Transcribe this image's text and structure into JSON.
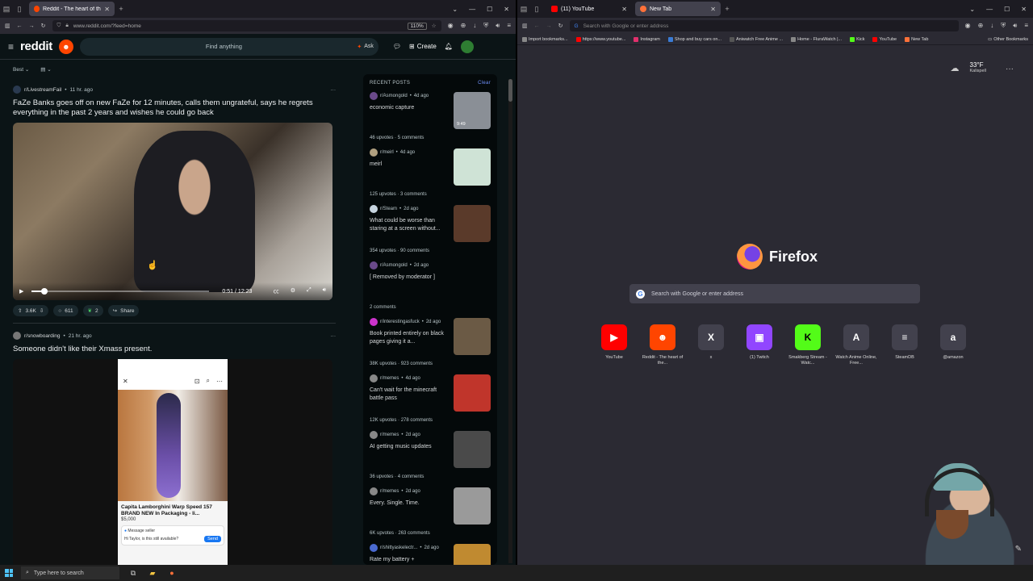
{
  "left_browser": {
    "tab": {
      "title": "Reddit - The heart of the in"
    },
    "url": "www.reddit.com/?feed=home",
    "zoom": "110%"
  },
  "reddit": {
    "logo": "reddit",
    "search_placeholder": "Find anything",
    "ask_label": "Ask",
    "create_label": "Create",
    "sort_label": "Best"
  },
  "posts": [
    {
      "subreddit": "r/LivestreamFail",
      "time": "11 hr. ago",
      "title": "FaZe Banks goes off on new FaZe for 12 minutes, calls them ungrateful, says he regrets everything in the past 2 years and wishes he could go back",
      "video_time": "0:51 / 12:23",
      "progress_fraction": 0.069,
      "upvotes": "3.6K",
      "comments": "611",
      "awards": "2",
      "share_label": "Share"
    },
    {
      "subreddit": "r/snowboarding",
      "time": "21 hr. ago",
      "title": "Someone didn't like their Xmass present.",
      "listing_title": "Capita Lamborghini Warp Speed 157 BRAND NEW In Packaging - li...",
      "listing_price": "$5,000",
      "message_header": "Message seller",
      "message_text": "Hi Taylor, is this still available?",
      "send_label": "Send"
    }
  ],
  "recent_posts": {
    "heading": "RECENT POSTS",
    "clear_label": "Clear",
    "items": [
      {
        "sub": "r/Asmongold",
        "time": "4d ago",
        "title": "economic capture",
        "stats": "46 upvotes · 5 comments",
        "thumb_label": "9:49",
        "icon_color": "#6a4a8a",
        "thumb_color": "#8a8f96"
      },
      {
        "sub": "r/meirl",
        "time": "4d ago",
        "title": "meirl",
        "stats": "125 upvotes · 3 comments",
        "thumb_label": "",
        "icon_color": "#b0a080",
        "thumb_color": "#cfe3d6"
      },
      {
        "sub": "r/Steam",
        "time": "2d ago",
        "title": "What could be worse than staring at a screen without...",
        "stats": "354 upvotes · 90 comments",
        "thumb_label": "",
        "icon_color": "#c7d5e0",
        "thumb_color": "#5a3a2a"
      },
      {
        "sub": "r/Asmongold",
        "time": "2d ago",
        "title": "[ Removed by moderator ]",
        "stats": "2 comments",
        "thumb_label": "",
        "icon_color": "#6a4a8a",
        "thumb_color": ""
      },
      {
        "sub": "r/interestingasfuck",
        "time": "2d ago",
        "title": "Book printed entirely on black pages giving it a...",
        "stats": "38K upvotes · 923 comments",
        "thumb_label": "",
        "icon_color": "#cc33cc",
        "thumb_color": "#6b5a45"
      },
      {
        "sub": "r/memes",
        "time": "4d ago",
        "title": "Can't wait for the minecraft battle pass",
        "stats": "12K upvotes · 278 comments",
        "thumb_label": "",
        "icon_color": "#888888",
        "thumb_color": "#c0352b"
      },
      {
        "sub": "r/memes",
        "time": "2d ago",
        "title": "AI getting music updates",
        "stats": "36 upvotes · 4 comments",
        "thumb_label": "",
        "icon_color": "#888888",
        "thumb_color": "#4a4a4a"
      },
      {
        "sub": "r/memes",
        "time": "2d ago",
        "title": "Every. Single. Time.",
        "stats": "6K upvotes · 263 comments",
        "thumb_label": "",
        "icon_color": "#888888",
        "thumb_color": "#9a9a9a"
      },
      {
        "sub": "r/shittyaskelectr...",
        "time": "2d ago",
        "title": "Rate my battery +",
        "stats": "",
        "thumb_label": "",
        "icon_color": "#4a6ad0",
        "thumb_color": "#c08a30"
      }
    ]
  },
  "right_browser": {
    "tabs": [
      {
        "title": "(11) YouTube"
      },
      {
        "title": "New Tab"
      }
    ],
    "url_placeholder": "Search with Google or enter address",
    "bookmarks": [
      "Import bookmarks...",
      "https://www.youtube...",
      "Instagram",
      "Shop and buy cars on...",
      "Aniwatch Free Anime ...",
      "Home - FluraWatch |...",
      "Kick",
      "YouTube",
      "New Tab"
    ],
    "other_bookmarks": "Other Bookmarks",
    "weather": {
      "temp": "33°F",
      "location": "Kalispell"
    },
    "firefox_label": "Firefox",
    "search_placeholder": "Search with Google or enter address",
    "shortcuts": [
      {
        "label": "YouTube",
        "glyph": "▶",
        "color": "#ff0000",
        "fg": "#fff"
      },
      {
        "label": "Reddit - The heart of the...",
        "glyph": "☻",
        "color": "#ff4500",
        "fg": "#fff"
      },
      {
        "label": "x",
        "glyph": "X",
        "color": "#42414d",
        "fg": "#fff"
      },
      {
        "label": "(1) Twitch",
        "glyph": "▣",
        "color": "#9146ff",
        "fg": "#fff"
      },
      {
        "label": "Smakberg Stream - Watc...",
        "glyph": "K",
        "color": "#53fc18",
        "fg": "#000"
      },
      {
        "label": "Watch Anime Online, Free...",
        "glyph": "A",
        "color": "#42414d",
        "fg": "#fff"
      },
      {
        "label": "SteamDB",
        "glyph": "≡",
        "color": "#42414d",
        "fg": "#fff"
      },
      {
        "label": "@amazon",
        "glyph": "a",
        "color": "#42414d",
        "fg": "#fff"
      }
    ]
  },
  "taskbar": {
    "search_placeholder": "Type here to search"
  }
}
